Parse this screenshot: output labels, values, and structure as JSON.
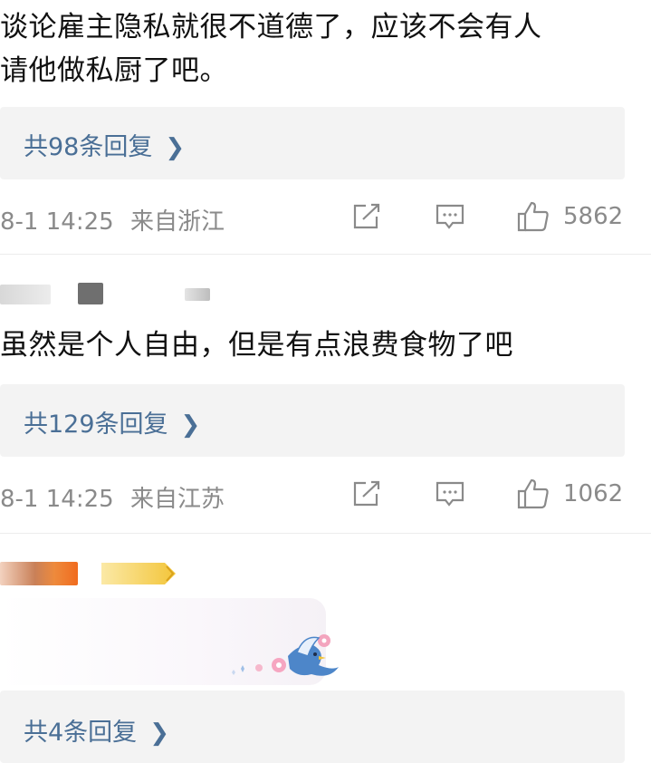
{
  "comments": [
    {
      "text_line1": "谈论雇主隐私就很不道德了，应该不会有人",
      "text_line2": "请他做私厨了吧。",
      "replies_label": "共98条回复",
      "time": "8-1 14:25",
      "location": "来自浙江",
      "likes": "5862"
    },
    {
      "text_line1": "虽然是个人自由，但是有点浪费食物了吧",
      "replies_label": "共129条回复",
      "time": "8-1 14:25",
      "location": "来自江苏",
      "likes": "1062"
    },
    {
      "replies_label": "共4条回复"
    }
  ],
  "icons": {
    "share": "share-icon",
    "comment": "comment-icon",
    "like": "thumbs-up-icon",
    "chevron": "chevron-right-icon"
  },
  "colors": {
    "link": "#4a6f96",
    "meta": "#8a8a8a",
    "reply_bg": "#f3f3f3",
    "text": "#111111"
  }
}
